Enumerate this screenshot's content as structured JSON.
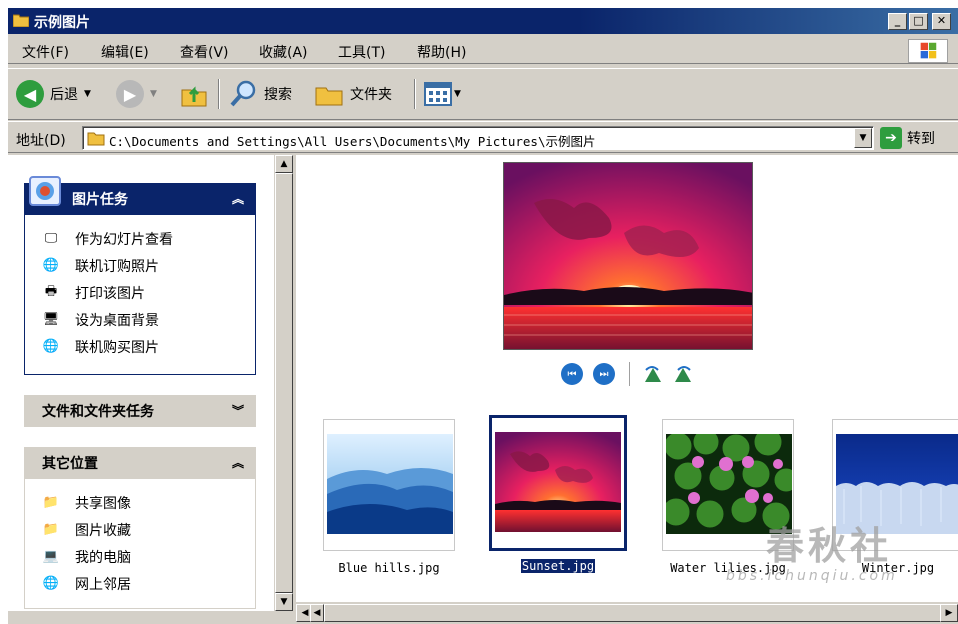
{
  "window": {
    "title": "示例图片"
  },
  "menu": [
    "文件(F)",
    "编辑(E)",
    "查看(V)",
    "收藏(A)",
    "工具(T)",
    "帮助(H)"
  ],
  "toolbar": {
    "back": "后退",
    "search": "搜索",
    "folders": "文件夹"
  },
  "address": {
    "label": "地址(D)",
    "path": "C:\\Documents and Settings\\All Users\\Documents\\My Pictures\\示例图片",
    "go": "转到"
  },
  "task_pane": {
    "picture_tasks": {
      "title": "图片任务",
      "items": [
        "作为幻灯片查看",
        "联机订购照片",
        "打印该图片",
        "设为桌面背景",
        "联机购买图片"
      ]
    },
    "file_tasks": {
      "title": "文件和文件夹任务"
    },
    "other_places": {
      "title": "其它位置",
      "items": [
        "共享图像",
        "图片收藏",
        "我的电脑",
        "网上邻居"
      ]
    }
  },
  "files": [
    "Blue hills.jpg",
    "Sunset.jpg",
    "Water lilies.jpg",
    "Winter.jpg"
  ],
  "selected_file": "Sunset.jpg",
  "watermark": {
    "main": "春秋社",
    "url": "bbs.ichunqiu.com"
  }
}
